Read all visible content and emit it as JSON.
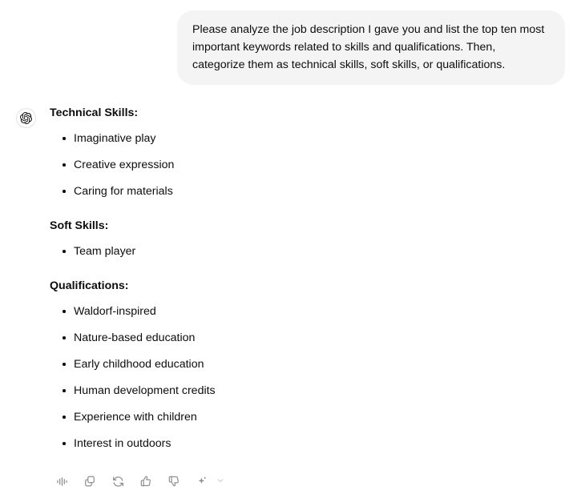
{
  "conversation": {
    "user_message": {
      "text": "Please analyze the job description I gave you and list the top ten most important keywords related to skills and qualifications. Then, categorize them as technical skills, soft skills, or qualifications."
    },
    "assistant_message": {
      "avatar_icon": "openai-logo-icon",
      "sections": [
        {
          "heading": "Technical Skills:",
          "items": [
            "Imaginative play",
            "Creative expression",
            "Caring for materials"
          ]
        },
        {
          "heading": "Soft Skills:",
          "items": [
            "Team player"
          ]
        },
        {
          "heading": "Qualifications:",
          "items": [
            "Waldorf-inspired",
            "Nature-based education",
            "Early childhood education",
            "Human development credits",
            "Experience with children",
            "Interest in outdoors"
          ]
        }
      ],
      "actions": [
        {
          "name": "read-aloud",
          "icon": "sound-wave-icon",
          "label": "Read aloud"
        },
        {
          "name": "copy",
          "icon": "copy-icon",
          "label": "Copy"
        },
        {
          "name": "regenerate",
          "icon": "refresh-icon",
          "label": "Regenerate"
        },
        {
          "name": "good-response",
          "icon": "thumbs-up-icon",
          "label": "Good response"
        },
        {
          "name": "bad-response",
          "icon": "thumbs-down-icon",
          "label": "Bad response"
        },
        {
          "name": "switch-model",
          "icon": "sparkle-icon",
          "label": "Switch model"
        },
        {
          "name": "more-options",
          "icon": "chevron-down-icon",
          "label": "More"
        }
      ]
    }
  },
  "theme": {
    "page_background": "#ffffff",
    "user_bubble_background": "#f4f4f4",
    "text_color": "#0d0d0d",
    "icon_color": "#8f8f8f",
    "chevron_color": "#c5c5c5"
  }
}
